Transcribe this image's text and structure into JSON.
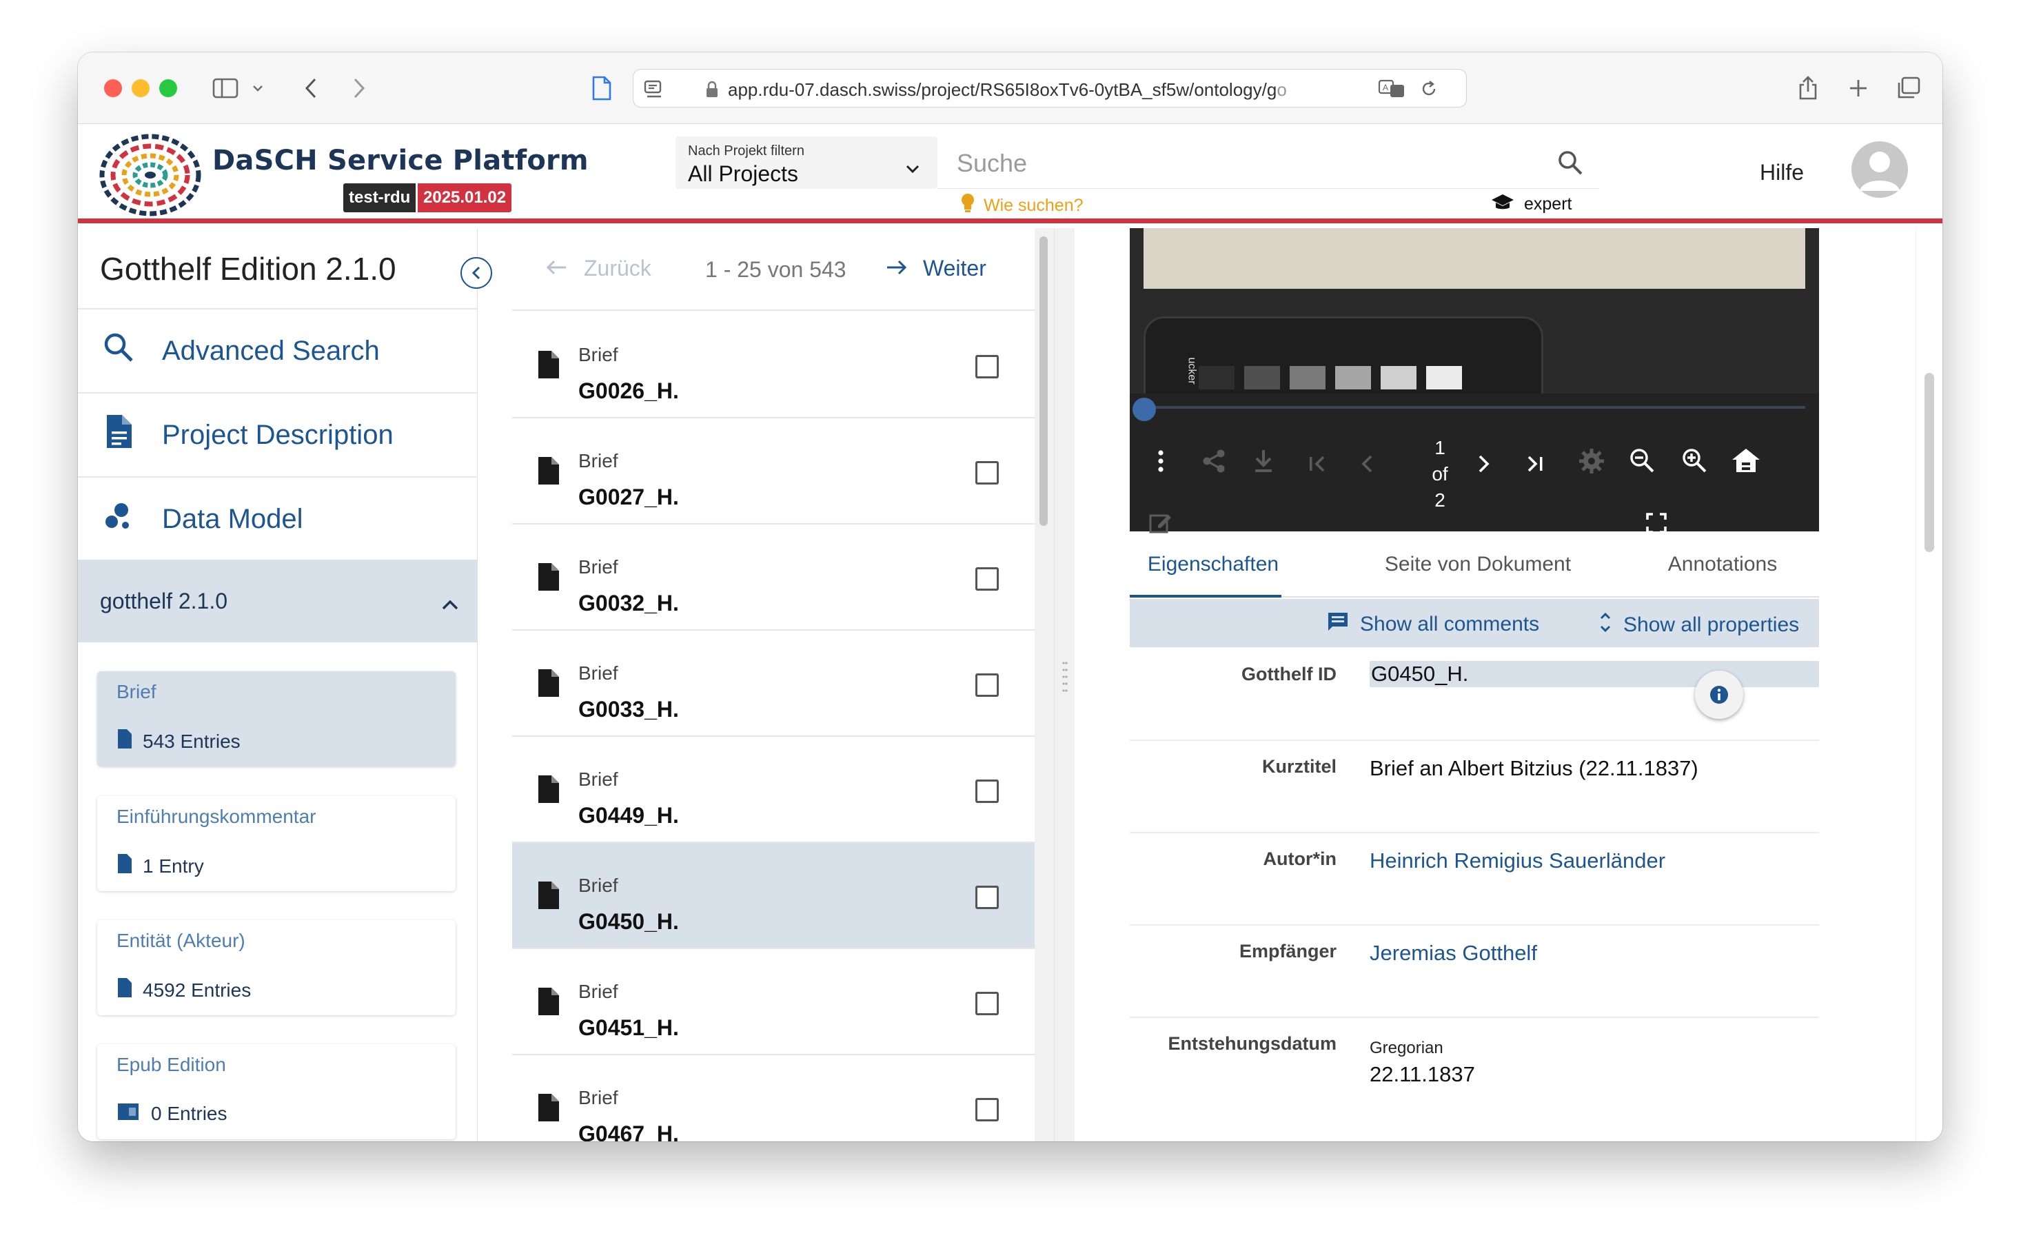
{
  "browser": {
    "url_main": "app.rdu-07.dasch.swiss/project/RS65I8oxTv6-0ytBA_sf5w/ontology/g",
    "url_faded": "o"
  },
  "header": {
    "brand": "DaSCH Service Platform",
    "env_badge": "test-rdu",
    "version_badge": "2025.01.02",
    "project_filter_label": "Nach Projekt filtern",
    "project_filter_value": "All Projects",
    "search_placeholder": "Suche",
    "how_to_search": "Wie suchen?",
    "expert_label": "expert",
    "help": "Hilfe"
  },
  "sidebar": {
    "project_title": "Gotthelf Edition 2.1.0",
    "nav": [
      {
        "label": "Advanced Search",
        "icon": "search-icon"
      },
      {
        "label": "Project Description",
        "icon": "document-icon"
      },
      {
        "label": "Data Model",
        "icon": "bubble-chart-icon"
      }
    ],
    "ontology": "gotthelf 2.1.0",
    "classes": [
      {
        "name": "Brief",
        "count": "543 Entries"
      },
      {
        "name": "Einführungskommentar",
        "count": "1 Entry"
      },
      {
        "name": "Entität (Akteur)",
        "count": "4592 Entries"
      },
      {
        "name": "Epub Edition",
        "count": "0 Entries"
      }
    ]
  },
  "results": {
    "prev_label": "Zurück",
    "range": "1 - 25 von 543",
    "next_label": "Weiter",
    "rows": [
      {
        "type": "Brief",
        "label": "G0026_H."
      },
      {
        "type": "Brief",
        "label": "G0027_H."
      },
      {
        "type": "Brief",
        "label": "G0032_H."
      },
      {
        "type": "Brief",
        "label": "G0033_H."
      },
      {
        "type": "Brief",
        "label": "G0449_H."
      },
      {
        "type": "Brief",
        "label": "G0450_H."
      },
      {
        "type": "Brief",
        "label": "G0451_H."
      },
      {
        "type": "Brief",
        "label": "G0467_H."
      }
    ]
  },
  "viewer": {
    "page_current": "1",
    "page_of": "of",
    "page_total": "2",
    "image_caption_fragment": "ucker",
    "tabs": [
      "Eigenschaften",
      "Seite von Dokument",
      "Annotations"
    ],
    "show_comments": "Show all comments",
    "show_properties": "Show all properties",
    "properties": [
      {
        "name": "Gotthelf ID",
        "value": "G0450_H."
      },
      {
        "name": "Kurztitel",
        "value": "Brief an Albert Bitzius (22.11.1837)"
      },
      {
        "name": "Autor*in",
        "value": "Heinrich Remigius Sauerländer"
      },
      {
        "name": "Empfänger",
        "value": "Jeremias Gotthelf"
      },
      {
        "name": "Entstehungsdatum",
        "calendar": "Gregorian",
        "value": "22.11.1837"
      }
    ]
  },
  "colors": {
    "accent": "#1d5591",
    "brand_red": "#d1323f",
    "selected_bg": "#d8e1ea"
  }
}
